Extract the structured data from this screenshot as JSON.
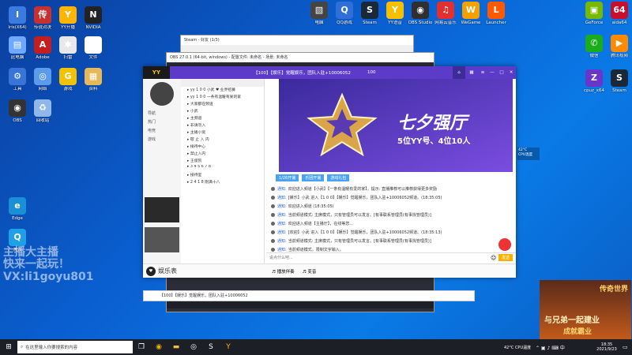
{
  "desktop": {
    "icons": [
      {
        "label": "Iris(X64)",
        "color": "#3b7be0",
        "glyph": "I"
      },
      {
        "label": "传说对决",
        "color": "#c9312f",
        "glyph": "传"
      },
      {
        "label": "YY开播",
        "color": "#ffb400",
        "glyph": "Y"
      },
      {
        "label": "NVIDIA",
        "color": "#222",
        "glyph": "N"
      },
      {
        "label": "此电脑",
        "color": "#6fa8ff",
        "glyph": "▤"
      },
      {
        "label": "Adobe",
        "color": "#c41e1e",
        "glyph": "A"
      },
      {
        "label": "扫雷",
        "color": "#e8e8e8",
        "glyph": "✱"
      },
      {
        "label": "文件",
        "color": "#ffffff",
        "glyph": "▭"
      },
      {
        "label": "工具",
        "color": "#3875d7",
        "glyph": "⚙"
      },
      {
        "label": "网络",
        "color": "#5c9bea",
        "glyph": "◎"
      },
      {
        "label": "游戏",
        "color": "#f2c200",
        "glyph": "G"
      },
      {
        "label": "资料",
        "color": "#e5b85a",
        "glyph": "▦"
      },
      {
        "label": "OBS",
        "color": "#333",
        "glyph": "◉"
      },
      {
        "label": "回收站",
        "color": "#8fb7e8",
        "glyph": "♻"
      },
      {
        "label": "Edge",
        "color": "#1a8fd6",
        "glyph": "e"
      },
      {
        "label": "腾讯",
        "color": "#1fa0e6",
        "glyph": "Q"
      }
    ],
    "top_icons": [
      {
        "label": "电脑",
        "color": "#444",
        "glyph": "▧"
      },
      {
        "label": "QQ游戏",
        "color": "#2f6fd6",
        "glyph": "Q"
      },
      {
        "label": "Steam",
        "color": "#1b2838",
        "glyph": "S"
      },
      {
        "label": "YY语音",
        "color": "#f6c000",
        "glyph": "Y"
      },
      {
        "label": "OBS Studio",
        "color": "#302e31",
        "glyph": "◉"
      },
      {
        "label": "网易云音乐",
        "color": "#e03030",
        "glyph": "♫"
      },
      {
        "label": "WeGame",
        "color": "#f2a100",
        "glyph": "W"
      },
      {
        "label": "Launcher",
        "color": "#ff5a00",
        "glyph": "L"
      },
      {
        "label": "GeForce",
        "color": "#76b900",
        "glyph": "▣"
      },
      {
        "label": "aida64",
        "color": "#c8102e",
        "glyph": "64"
      },
      {
        "label": "微信",
        "color": "#1aad19",
        "glyph": "✆"
      },
      {
        "label": "腾讯视频",
        "color": "#ff8a00",
        "glyph": "▶"
      },
      {
        "label": "cpuz_x64",
        "color": "#6a35c9",
        "glyph": "Z"
      },
      {
        "label": "Steam",
        "color": "#1b2838",
        "glyph": "S"
      }
    ],
    "watermark": {
      "line1": "主播大主播",
      "line2": "快来一起玩！",
      "line3": "VX:li1goyu801"
    },
    "weather": {
      "temp": "42°C",
      "desc": "CPU温度"
    },
    "ad": {
      "title": "与兄弟一起建业",
      "sub": "成就霸业",
      "game": "传奇世界"
    }
  },
  "windows": {
    "back1_title": "Steam - 好友 (1/3)",
    "back2_title": "OBS 27.0.1 (64-bit, windows) - 配置文件: 未命名 - 场景: 未命名"
  },
  "yy": {
    "header": "【100】【娱乐】觉醒娱乐，团队入驻+10006052",
    "header_count": "100",
    "nav_tabs": [
      "导航",
      "热门",
      "电竞",
      "游戏"
    ],
    "tree": [
      "yy 1 0 0 小武 ♥ 业界招募",
      "yy 1 0 0 一条有温暖有爱的家",
      "大家都在频道",
      "小武",
      "主频道",
      "非请勿入",
      "主播小窝",
      "歇 止 入 内",
      "接待中心",
      "禁止入内",
      "王俊凯",
      "3 4 5 6 7 8",
      "接待室",
      "2 4 1 8 刚满十八"
    ],
    "banner": {
      "title": "七夕强厅",
      "sub": "5位YY号、4位10人",
      "bg1": "#3a2a9c",
      "bg2": "#7a4de0"
    },
    "room_tabs": [
      "1/26开播",
      "乐团开播",
      "游戏礼包"
    ],
    "chat": [
      {
        "tag": "通知:",
        "text": "欢迎进入频道【小武】【一条有温暖有爱的家】，提示: 直播推荐可以推荐获得更多奖励"
      },
      {
        "tag": "通知:",
        "text": "[娱乐】小武 进入【1 0 0】【娱乐】觉醒娱乐，团队入驻+10006052频道。(18:35:05)"
      },
      {
        "tag": "通知:",
        "text": "欢迎进入频道 (18:35:05)"
      },
      {
        "tag": "通知:",
        "text": "当前频道模式: 主席模式，只有管理员可以发言。[有事联系管理员(有事找管理员)]"
      },
      {
        "tag": "通知:",
        "text": "欢迎进入频道【主播厅】，在线等您..."
      },
      {
        "tag": "通知:",
        "text": "[欢迎】小武 进入【1 0 0】【娱乐】觉醒娱乐，团队入驻+10006052频道。(18:35:13)"
      },
      {
        "tag": "通知:",
        "text": "当前频道模式: 主席模式，只有管理员可以发言。[有事联系管理员(有事找管理员)]"
      },
      {
        "tag": "通知:",
        "text": "当前频道模式，限制文字输入。"
      }
    ],
    "input_placeholder": "说点什么吧...",
    "send_label": "发送",
    "bottom_tools": [
      "播放伴奏",
      "变音"
    ],
    "bottom_status": "【100】【娱乐】觉醒娱乐，团队入驻+10006052",
    "left_footer": "娱乐表"
  },
  "taskbar": {
    "search_placeholder": "在这里输入你要搜索的内容",
    "temp": "42°C CPU温度",
    "time": "18:35",
    "date": "2021/9/23"
  }
}
